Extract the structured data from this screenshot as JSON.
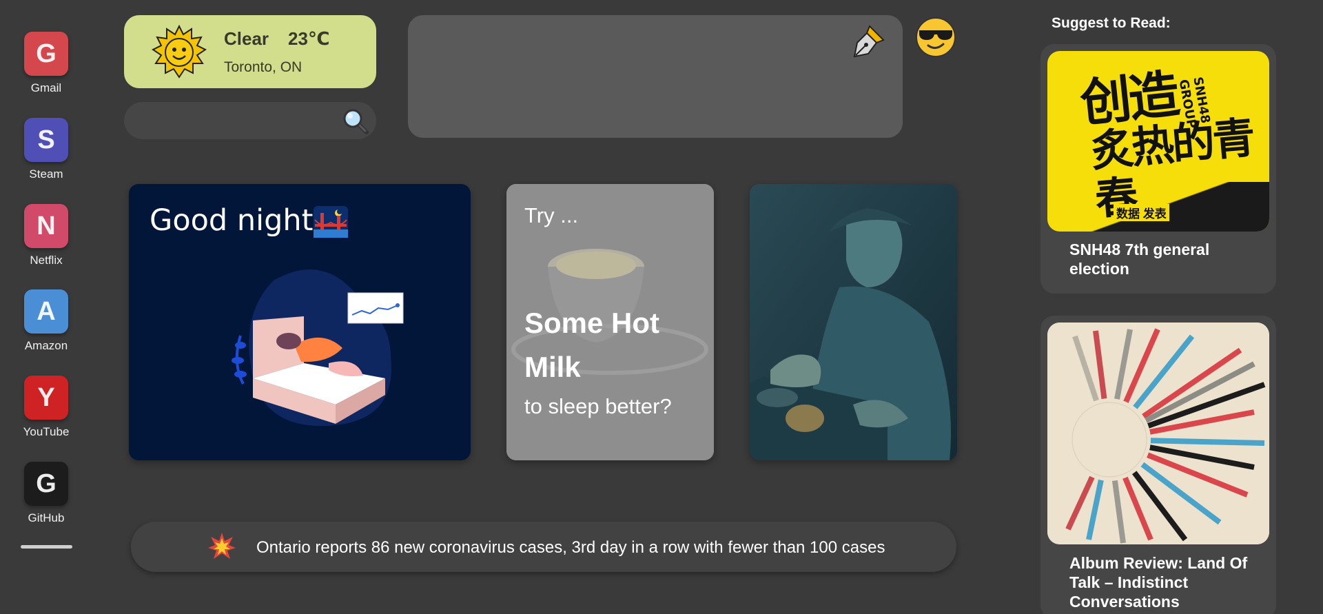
{
  "sidebar": {
    "items": [
      {
        "letter": "G",
        "label": "Gmail",
        "color": "#d4474d"
      },
      {
        "letter": "S",
        "label": "Steam",
        "color": "#4f4fb6"
      },
      {
        "letter": "N",
        "label": "Netflix",
        "color": "#d24a6a"
      },
      {
        "letter": "A",
        "label": "Amazon",
        "color": "#4a8fd6"
      },
      {
        "letter": "Y",
        "label": "YouTube",
        "color": "#cf2225"
      },
      {
        "letter": "G",
        "label": "GitHub",
        "color": "#1c1c1c"
      }
    ]
  },
  "weather": {
    "condition": "Clear",
    "temperature": "23℃",
    "location": "Toronto, ON",
    "icon": "sun-with-face-icon",
    "background": "#d2de8b"
  },
  "search": {
    "value": "",
    "icon": "magnifying-glass-icon"
  },
  "note": {
    "icon": "fountain-pen-icon",
    "avatar": "sunglasses-face-icon"
  },
  "cards": {
    "night": {
      "greeting": "Good night",
      "icon": "bridge-at-night-icon",
      "background": "#011639"
    },
    "milk": {
      "prefix": "Try ...",
      "headline": "Some Hot Milk",
      "subline": "to sleep better?"
    },
    "art": {
      "subject": "blind-man-painting"
    }
  },
  "news": {
    "icon": "collision-icon",
    "text": "Ontario reports 86 new coronavirus cases, 3rd day in a row with fewer than 100 cases"
  },
  "suggest": {
    "title": "Suggest to Read:",
    "items": [
      {
        "title": "SNH48 7th general election",
        "image": "snh48-poster"
      },
      {
        "title": "Album Review: Land Of Talk – Indistinct Conversations",
        "image": "album-cover-radial"
      }
    ],
    "poster": {
      "line1": "创造",
      "line2": "炙热的青春",
      "side": "SNH48 GROUP",
      "tag": "数据 发表"
    }
  }
}
